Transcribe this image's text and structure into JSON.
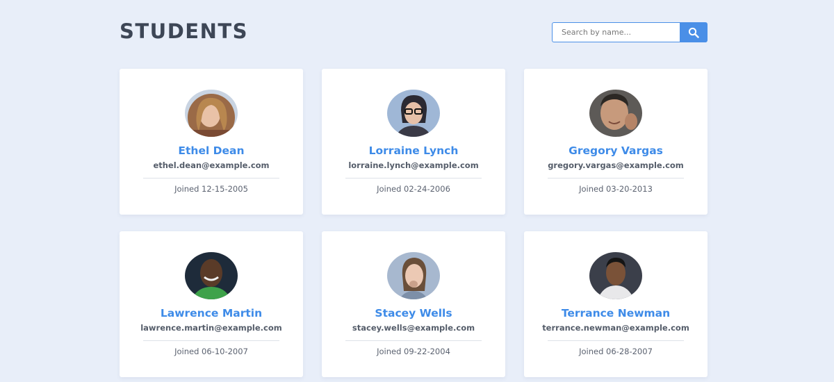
{
  "header": {
    "title": "STUDENTS",
    "search_placeholder": "Search by name...",
    "search_button_icon": "search-icon"
  },
  "colors": {
    "accent": "#4a8fe7",
    "name": "#3e8be8",
    "background": "#e8eef9"
  },
  "students": [
    {
      "name": "Ethel Dean",
      "email": "ethel.dean@example.com",
      "joined": "Joined 12-15-2005"
    },
    {
      "name": "Lorraine Lynch",
      "email": "lorraine.lynch@example.com",
      "joined": "Joined 02-24-2006"
    },
    {
      "name": "Gregory Vargas",
      "email": "gregory.vargas@example.com",
      "joined": "Joined 03-20-2013"
    },
    {
      "name": "Lawrence Martin",
      "email": "lawrence.martin@example.com",
      "joined": "Joined 06-10-2007"
    },
    {
      "name": "Stacey Wells",
      "email": "stacey.wells@example.com",
      "joined": "Joined 09-22-2004"
    },
    {
      "name": "Terrance Newman",
      "email": "terrance.newman@example.com",
      "joined": "Joined 06-28-2007"
    }
  ]
}
